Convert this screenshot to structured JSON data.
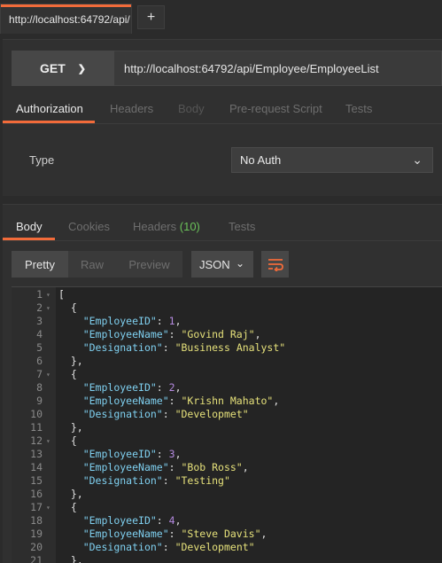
{
  "tab": {
    "title": "http://localhost:64792/api/",
    "new_tab": "+"
  },
  "request": {
    "method": "GET",
    "url": "http://localhost:64792/api/Employee/EmployeeList",
    "tabs": [
      "Authorization",
      "Headers",
      "Body",
      "Pre-request Script",
      "Tests"
    ],
    "active_tab": "Authorization"
  },
  "auth": {
    "type_label": "Type",
    "type_value": "No Auth"
  },
  "response": {
    "tabs": {
      "body": "Body",
      "cookies": "Cookies",
      "headers": "Headers",
      "headers_count": "(10)",
      "tests": "Tests"
    },
    "view_modes": [
      "Pretty",
      "Raw",
      "Preview"
    ],
    "format": "JSON",
    "lines": [
      {
        "n": "1",
        "fold": true,
        "text": "["
      },
      {
        "n": "2",
        "fold": true,
        "text": "  {"
      },
      {
        "n": "3",
        "key": "EmployeeID",
        "num": "1"
      },
      {
        "n": "4",
        "key": "EmployeeName",
        "str": "Govind Raj"
      },
      {
        "n": "5",
        "key": "Designation",
        "str": "Business Analyst",
        "last": true
      },
      {
        "n": "6",
        "text": "  },"
      },
      {
        "n": "7",
        "fold": true,
        "text": "  {"
      },
      {
        "n": "8",
        "key": "EmployeeID",
        "num": "2"
      },
      {
        "n": "9",
        "key": "EmployeeName",
        "str": "Krishn Mahato"
      },
      {
        "n": "10",
        "key": "Designation",
        "str": "Developmet",
        "last": true
      },
      {
        "n": "11",
        "text": "  },"
      },
      {
        "n": "12",
        "fold": true,
        "text": "  {"
      },
      {
        "n": "13",
        "key": "EmployeeID",
        "num": "3"
      },
      {
        "n": "14",
        "key": "EmployeeName",
        "str": "Bob Ross"
      },
      {
        "n": "15",
        "key": "Designation",
        "str": "Testing",
        "last": true
      },
      {
        "n": "16",
        "text": "  },"
      },
      {
        "n": "17",
        "fold": true,
        "text": "  {"
      },
      {
        "n": "18",
        "key": "EmployeeID",
        "num": "4"
      },
      {
        "n": "19",
        "key": "EmployeeName",
        "str": "Steve Davis"
      },
      {
        "n": "20",
        "key": "Designation",
        "str": "Development",
        "last": true
      },
      {
        "n": "21",
        "text": "  },"
      }
    ]
  }
}
